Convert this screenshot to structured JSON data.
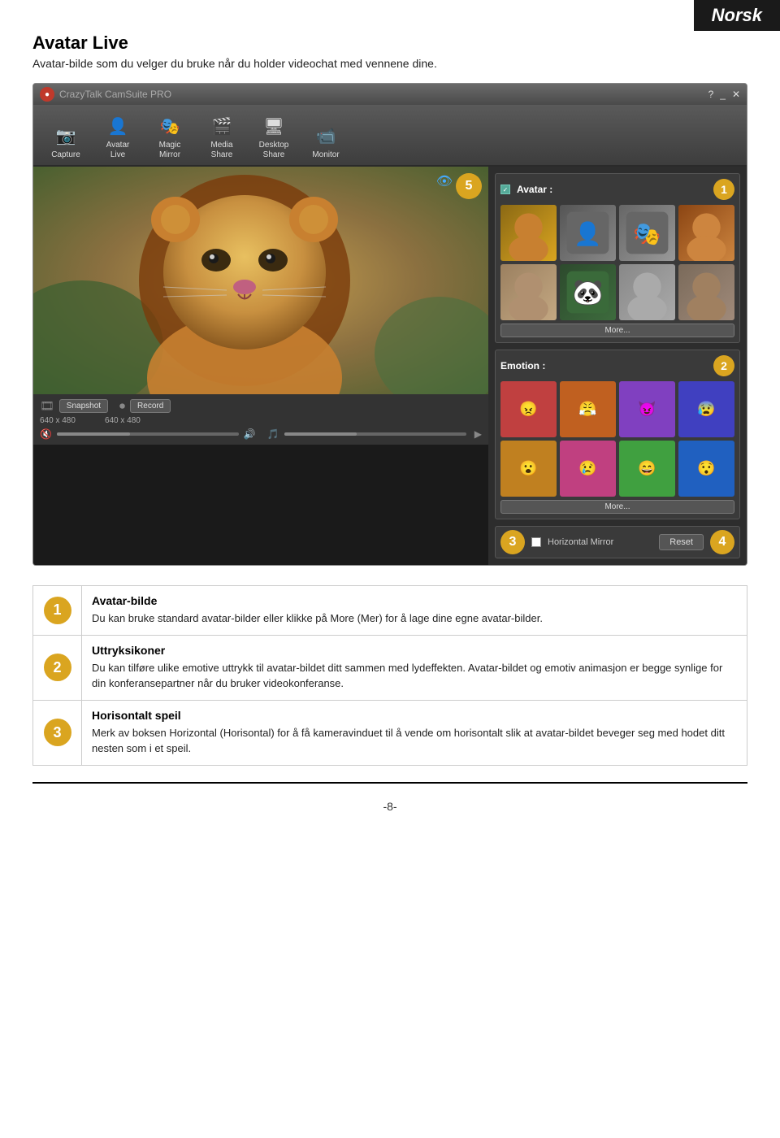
{
  "page": {
    "language_badge": "Norsk",
    "footer_text": "-8-"
  },
  "header": {
    "title": "Avatar Live",
    "subtitle": "Avatar-bilde som du velger du bruke når du holder videochat med vennene dine."
  },
  "app": {
    "title_bar": {
      "app_icon": "●",
      "app_name": "CrazyTalk",
      "app_name_suffix": " CamSuite PRO",
      "help_btn": "?",
      "min_btn": "_",
      "close_btn": "✕"
    },
    "toolbar": {
      "buttons": [
        {
          "id": "capture",
          "label": "Capture",
          "icon": "📷"
        },
        {
          "id": "avatar-live",
          "label": "Avatar\nLive",
          "icon": "👤"
        },
        {
          "id": "magic-mirror",
          "label": "Magic\nMirror",
          "icon": "🎭"
        },
        {
          "id": "media-share",
          "label": "Media\nShare",
          "icon": "🎬"
        },
        {
          "id": "desktop-share",
          "label": "Desktop\nShare",
          "icon": "🖥"
        },
        {
          "id": "monitor",
          "label": "Monitor",
          "icon": "📹"
        }
      ]
    },
    "right_panel": {
      "avatar_label": "Avatar :",
      "more_btn_label": "More...",
      "emotion_label": "Emotion :",
      "emotion_more_btn": "More...",
      "mirror_label": "Horizontal Mirror",
      "reset_btn": "Reset"
    },
    "video_controls": {
      "snapshot_btn": "Snapshot",
      "record_btn": "Record",
      "snapshot_size": "640 x 480",
      "record_size": "640 x 480"
    }
  },
  "descriptions": [
    {
      "num": "1",
      "title": "Avatar-bilde",
      "text": "Du kan bruke standard avatar-bilder eller klikke på More (Mer) for å lage dine egne avatar-bilder."
    },
    {
      "num": "2",
      "title": "Uttryksikoner",
      "text": "Du kan tilføre ulike emotive uttrykk til avatar-bildet ditt sammen med lydeffekten. Avatar-bildet og emotiv animasjon er begge synlige for din konferansepartner når du bruker videokonferanse."
    },
    {
      "num": "3",
      "title": "Horisontalt speil",
      "text": "Merk av boksen Horizontal (Horisontal) for å få kameravinduet til å vende om horisontalt slik at avatar-bildet beveger seg med hodet ditt nesten som i et speil."
    }
  ],
  "badges": {
    "b1": "1",
    "b2": "2",
    "b3": "3",
    "b4": "4",
    "b5": "5"
  }
}
